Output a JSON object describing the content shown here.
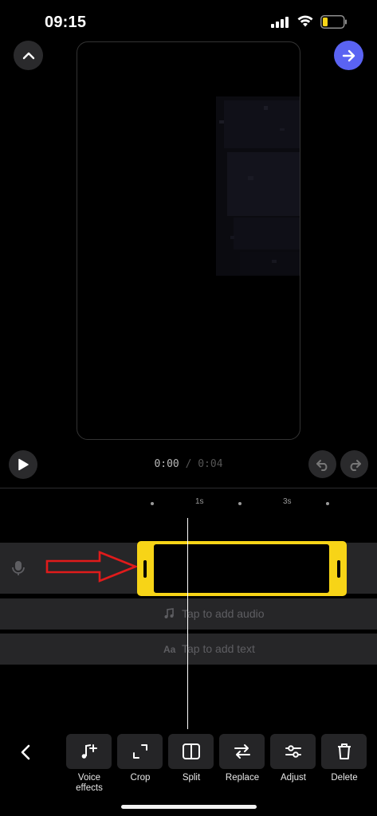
{
  "status_bar": {
    "time": "09:15"
  },
  "player": {
    "current_time": "0:00",
    "separator": "/",
    "total_time": "0:04"
  },
  "ruler": {
    "labels": [
      "1s",
      "3s"
    ]
  },
  "tracks": {
    "audio_placeholder": "Tap to add audio",
    "text_placeholder": "Tap to add text",
    "text_icon": "Aa"
  },
  "toolbar": {
    "tools": [
      {
        "label": "Voice effects",
        "icon": "music-note-plus-icon"
      },
      {
        "label": "Crop",
        "icon": "crop-icon"
      },
      {
        "label": "Split",
        "icon": "split-icon"
      },
      {
        "label": "Replace",
        "icon": "replace-icon"
      },
      {
        "label": "Adjust",
        "icon": "sliders-icon"
      },
      {
        "label": "Delete",
        "icon": "trash-icon"
      }
    ]
  },
  "colors": {
    "accent": "#5a63f2",
    "clip_highlight": "#f7d417",
    "annotation_arrow": "#e01b1b"
  }
}
